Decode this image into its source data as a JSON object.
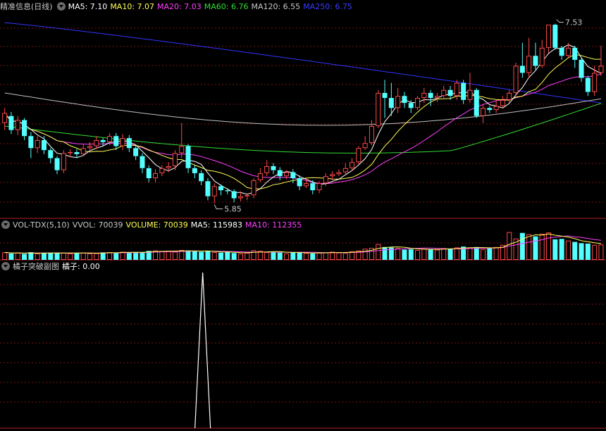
{
  "colors": {
    "up": "#ff4a4a",
    "down": "#54ffff",
    "ma5": "#ffffff",
    "ma10": "#ffff55",
    "ma20": "#ff40ff",
    "ma60": "#33dd33",
    "ma120": "#c0c0c0",
    "ma250": "#3333ff",
    "grid": "#7a1515",
    "divider": "#b52020",
    "text": "#c8c8c8"
  },
  "main_panel": {
    "title": "精准信息(日线)",
    "indicators": [
      {
        "label": "MA5: 7.10",
        "color": "#ffffff"
      },
      {
        "label": "MA10: 7.07",
        "color": "#ffff55"
      },
      {
        "label": "MA20: 7.03",
        "color": "#ff40ff"
      },
      {
        "label": "MA60: 6.76",
        "color": "#33dd33"
      },
      {
        "label": "MA120: 6.55",
        "color": "#c8c8c8"
      },
      {
        "label": "MA250: 6.75",
        "color": "#3a3aff"
      }
    ],
    "high_label": "7.53",
    "low_label": "5.85"
  },
  "volume_panel": {
    "title": "VOL-TDX(5,10)",
    "indicators": [
      {
        "label": "VVOL: 70039",
        "color": "#c8c8c8"
      },
      {
        "label": "VOLUME: 70039",
        "color": "#ffff55"
      },
      {
        "label": "MA5: 115983",
        "color": "#ffffff"
      },
      {
        "label": "MA10: 112355",
        "color": "#ff40ff"
      }
    ]
  },
  "sub_panel": {
    "title": "橘子突破副图",
    "indicators": [
      {
        "label": "橘子: 0.00",
        "color": "#ffffff"
      }
    ]
  },
  "chart_data": {
    "type": "candlestick",
    "price_range": [
      5.6,
      7.65
    ],
    "candles": [
      [
        6.55,
        6.65,
        6.7,
        6.48
      ],
      [
        6.62,
        6.48,
        6.66,
        6.44
      ],
      [
        6.48,
        6.58,
        6.62,
        6.43
      ],
      [
        6.58,
        6.42,
        6.6,
        6.38
      ],
      [
        6.42,
        6.3,
        6.46,
        6.2
      ],
      [
        6.3,
        6.38,
        6.42,
        6.25
      ],
      [
        6.38,
        6.28,
        6.42,
        6.24
      ],
      [
        6.28,
        6.2,
        6.3,
        6.15
      ],
      [
        6.2,
        6.08,
        6.22,
        6.04
      ],
      [
        6.08,
        6.25,
        6.28,
        6.05
      ],
      [
        6.25,
        6.26,
        6.29,
        6.21
      ],
      [
        6.26,
        6.24,
        6.29,
        6.2
      ],
      [
        6.24,
        6.3,
        6.34,
        6.22
      ],
      [
        6.3,
        6.32,
        6.36,
        6.27
      ],
      [
        6.32,
        6.38,
        6.42,
        6.29
      ],
      [
        6.38,
        6.36,
        6.4,
        6.32
      ],
      [
        6.36,
        6.42,
        6.45,
        6.33
      ],
      [
        6.42,
        6.32,
        6.45,
        6.28
      ],
      [
        6.32,
        6.4,
        6.44,
        6.28
      ],
      [
        6.4,
        6.3,
        6.43,
        6.26
      ],
      [
        6.3,
        6.22,
        6.33,
        6.18
      ],
      [
        6.22,
        6.1,
        6.25,
        6.05
      ],
      [
        6.1,
        6.0,
        6.13,
        5.96
      ],
      [
        6.0,
        6.05,
        6.09,
        5.96
      ],
      [
        6.05,
        6.1,
        6.13,
        6.02
      ],
      [
        6.1,
        6.12,
        6.16,
        6.06
      ],
      [
        6.12,
        6.25,
        6.28,
        6.08
      ],
      [
        6.25,
        6.32,
        6.55,
        6.2
      ],
      [
        6.32,
        6.1,
        6.34,
        6.05
      ],
      [
        6.1,
        6.05,
        6.13,
        6.0
      ],
      [
        6.05,
        5.97,
        6.08,
        5.93
      ],
      [
        5.97,
        5.82,
        6.0,
        5.78
      ],
      [
        5.82,
        5.92,
        5.95,
        5.75
      ],
      [
        5.92,
        5.88,
        5.94,
        5.83
      ],
      [
        5.88,
        5.87,
        5.9,
        5.84
      ],
      [
        5.87,
        5.8,
        5.89,
        5.76
      ],
      [
        5.8,
        5.82,
        5.87,
        5.77
      ],
      [
        5.82,
        5.83,
        5.85,
        5.78
      ],
      [
        5.83,
        5.98,
        6.0,
        5.8
      ],
      [
        5.98,
        6.05,
        6.1,
        5.96
      ],
      [
        6.05,
        6.12,
        6.18,
        6.02
      ],
      [
        6.12,
        6.08,
        6.15,
        6.04
      ],
      [
        6.08,
        6.02,
        6.11,
        5.98
      ],
      [
        6.02,
        6.06,
        6.08,
        5.99
      ],
      [
        6.06,
        6.0,
        6.09,
        5.95
      ],
      [
        6.0,
        5.92,
        6.03,
        5.88
      ],
      [
        5.92,
        5.95,
        6.0,
        5.9
      ],
      [
        5.95,
        5.88,
        5.98,
        5.84
      ],
      [
        5.88,
        5.95,
        5.97,
        5.85
      ],
      [
        5.95,
        6.02,
        6.05,
        5.92
      ],
      [
        6.02,
        6.04,
        6.07,
        5.98
      ],
      [
        6.04,
        6.06,
        6.09,
        6.02
      ],
      [
        6.06,
        6.1,
        6.15,
        6.03
      ],
      [
        6.1,
        6.16,
        6.2,
        6.07
      ],
      [
        6.16,
        6.3,
        6.32,
        6.14
      ],
      [
        6.3,
        6.35,
        6.42,
        6.28
      ],
      [
        6.35,
        6.52,
        6.58,
        6.33
      ],
      [
        6.52,
        6.85,
        6.88,
        6.5
      ],
      [
        6.85,
        6.8,
        6.98,
        6.6
      ],
      [
        6.8,
        6.7,
        6.95,
        6.62
      ],
      [
        6.7,
        6.82,
        6.9,
        6.65
      ],
      [
        6.82,
        6.75,
        6.86,
        6.7
      ],
      [
        6.75,
        6.7,
        6.78,
        6.65
      ],
      [
        6.7,
        6.8,
        6.82,
        6.68
      ],
      [
        6.8,
        6.85,
        6.9,
        6.75
      ],
      [
        6.85,
        6.8,
        6.88,
        6.72
      ],
      [
        6.8,
        6.82,
        6.85,
        6.76
      ],
      [
        6.82,
        6.88,
        6.92,
        6.8
      ],
      [
        6.88,
        6.82,
        6.92,
        6.78
      ],
      [
        6.82,
        6.95,
        6.98,
        6.78
      ],
      [
        6.95,
        6.78,
        6.98,
        6.74
      ],
      [
        6.78,
        6.88,
        7.05,
        6.75
      ],
      [
        6.88,
        6.62,
        6.9,
        6.6
      ],
      [
        6.62,
        6.7,
        6.74,
        6.55
      ],
      [
        6.7,
        6.68,
        6.72,
        6.65
      ],
      [
        6.68,
        6.72,
        6.78,
        6.65
      ],
      [
        6.72,
        6.78,
        6.82,
        6.7
      ],
      [
        6.78,
        6.85,
        6.88,
        6.75
      ],
      [
        6.85,
        7.12,
        7.15,
        6.82
      ],
      [
        7.12,
        7.05,
        7.35,
        7.0
      ],
      [
        7.05,
        7.22,
        7.4,
        7.0
      ],
      [
        7.22,
        7.12,
        7.35,
        7.08
      ],
      [
        7.12,
        7.3,
        7.38,
        7.1
      ],
      [
        7.3,
        7.53,
        7.53,
        7.25
      ],
      [
        7.53,
        7.3,
        7.54,
        7.28
      ],
      [
        7.3,
        7.22,
        7.32,
        7.18
      ],
      [
        7.22,
        7.3,
        7.35,
        7.2
      ],
      [
        7.3,
        7.18,
        7.32,
        7.1
      ],
      [
        7.18,
        7.0,
        7.2,
        6.96
      ],
      [
        7.0,
        6.86,
        7.02,
        6.82
      ],
      [
        6.86,
        7.05,
        7.12,
        6.82
      ],
      [
        7.05,
        7.12,
        7.32,
        7.02
      ]
    ],
    "volumes": [
      35,
      30,
      33,
      28,
      36,
      30,
      32,
      34,
      31,
      33,
      30,
      32,
      34,
      30,
      31,
      35,
      36,
      34,
      38,
      33,
      37,
      36,
      42,
      44,
      40,
      42,
      38,
      46,
      44,
      40,
      38,
      40,
      36,
      34,
      38,
      32,
      30,
      33,
      45,
      42,
      36,
      38,
      34,
      30,
      36,
      34,
      32,
      30,
      33,
      36,
      38,
      34,
      32,
      40,
      44,
      52,
      56,
      74,
      60,
      58,
      55,
      48,
      50,
      46,
      52,
      50,
      48,
      55,
      52,
      58,
      62,
      56,
      60,
      50,
      54,
      60,
      70,
      130,
      100,
      126,
      120,
      110,
      122,
      128,
      96,
      98,
      90,
      84,
      78,
      76,
      70,
      72
    ],
    "sub_signal": {
      "index": 30,
      "value": 1.0
    }
  }
}
